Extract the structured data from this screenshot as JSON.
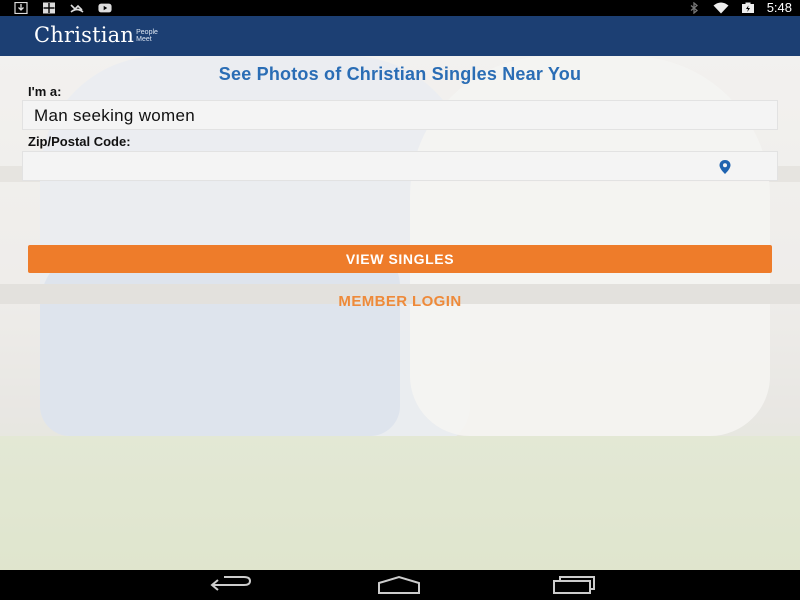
{
  "status_bar": {
    "time": "5:48",
    "left_icons": [
      "download-icon",
      "gallery-icon",
      "missed-call-icon",
      "youtube-icon"
    ],
    "right_icons": [
      "bluetooth-icon",
      "wifi-icon",
      "battery-icon"
    ]
  },
  "header": {
    "logo_main": "Christian",
    "logo_sub": "People Meet"
  },
  "form": {
    "headline": "See Photos of Christian Singles Near You",
    "iam_label": "I'm a:",
    "iam_value": "Man seeking women",
    "zip_label": "Zip/Postal Code:",
    "zip_value": "",
    "location_icon": "location-pin-icon",
    "view_button": "VIEW SINGLES",
    "login_link": "MEMBER LOGIN"
  },
  "colors": {
    "header_bg": "#1c3f73",
    "headline": "#2a6db5",
    "accent": "#ee7c2a",
    "pin": "#1f63b0"
  },
  "nav_bar": {
    "icons": [
      "back-icon",
      "home-icon",
      "recent-apps-icon"
    ]
  }
}
